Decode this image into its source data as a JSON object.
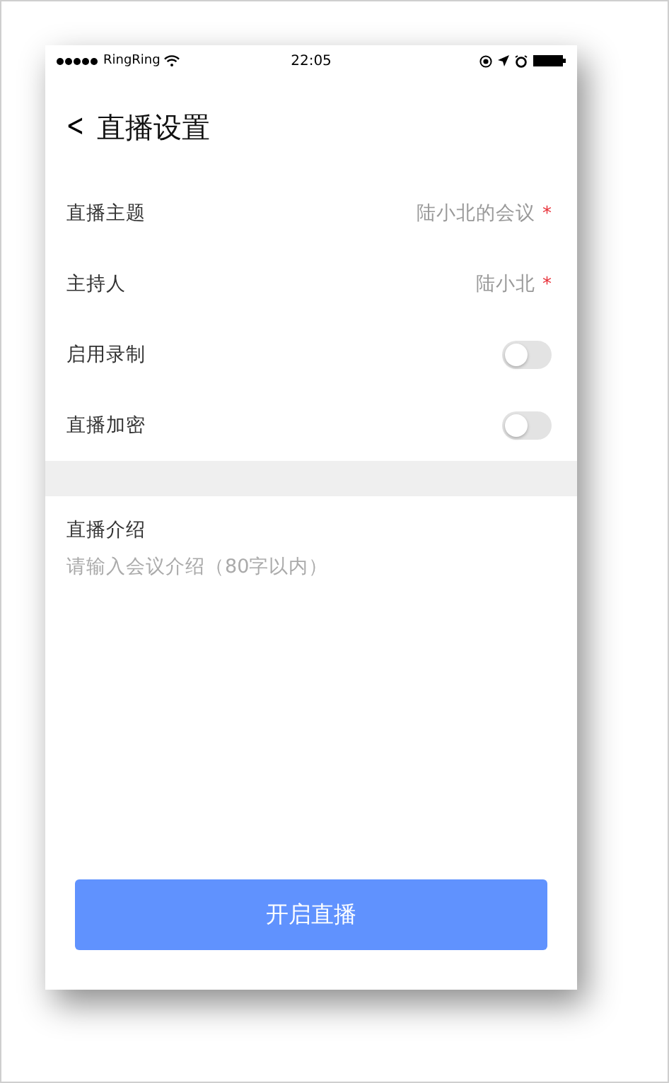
{
  "status_bar": {
    "carrier": "RingRing",
    "time": "22:05"
  },
  "header": {
    "back": "<",
    "title": "直播设置"
  },
  "settings": [
    {
      "kind": "text",
      "label": "直播主题",
      "value": "陆小北的会议",
      "required": true,
      "required_mark": "*"
    },
    {
      "kind": "text",
      "label": "主持人",
      "value": "陆小北",
      "required": true,
      "required_mark": "*"
    },
    {
      "kind": "toggle",
      "label": "启用录制",
      "on": false
    },
    {
      "kind": "toggle",
      "label": "直播加密",
      "on": false
    }
  ],
  "intro": {
    "label": "直播介绍",
    "placeholder": "请输入会议介绍（80字以内）"
  },
  "start_button": "开启直播"
}
